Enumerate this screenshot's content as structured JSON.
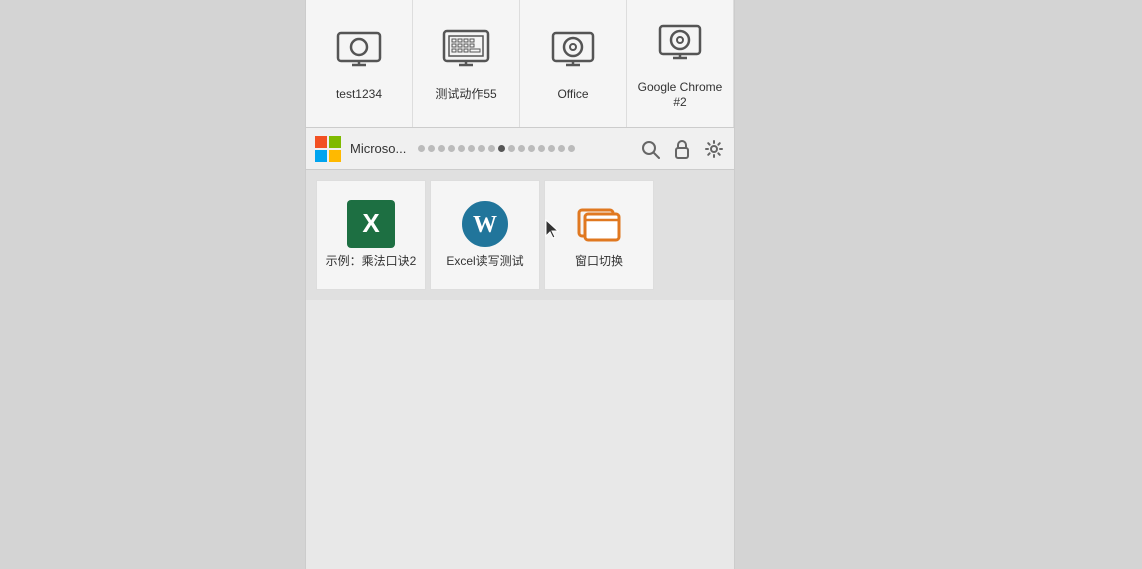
{
  "tabs": [
    {
      "id": "test1234",
      "label": "test1234",
      "icon": "monitor-icon"
    },
    {
      "id": "ceshi-dongzuo55",
      "label": "测试动作55",
      "icon": "monitor-icon"
    },
    {
      "id": "office",
      "label": "Office",
      "icon": "monitor-icon"
    },
    {
      "id": "google-chrome-2",
      "label": "Google Chrome #2",
      "icon": "monitor-icon"
    }
  ],
  "toolbar": {
    "title": "Microso...",
    "logo_label": "Microsoft logo"
  },
  "dots": {
    "total": 16,
    "active_index": 8
  },
  "grid_items": [
    {
      "id": "example-multiplication",
      "label": "示例：乘法口诀2",
      "icon": "excel-icon"
    },
    {
      "id": "excel-read-write",
      "label": "Excel读写测试",
      "icon": "wordpress-icon"
    },
    {
      "id": "window-switch",
      "label": "窗口切换",
      "icon": "window-switch-icon"
    }
  ],
  "toolbar_icons": [
    {
      "id": "search",
      "symbol": "🔍",
      "label": "search-icon"
    },
    {
      "id": "lock",
      "symbol": "🔒",
      "label": "lock-icon"
    },
    {
      "id": "settings",
      "symbol": "⚙",
      "label": "settings-icon"
    }
  ]
}
